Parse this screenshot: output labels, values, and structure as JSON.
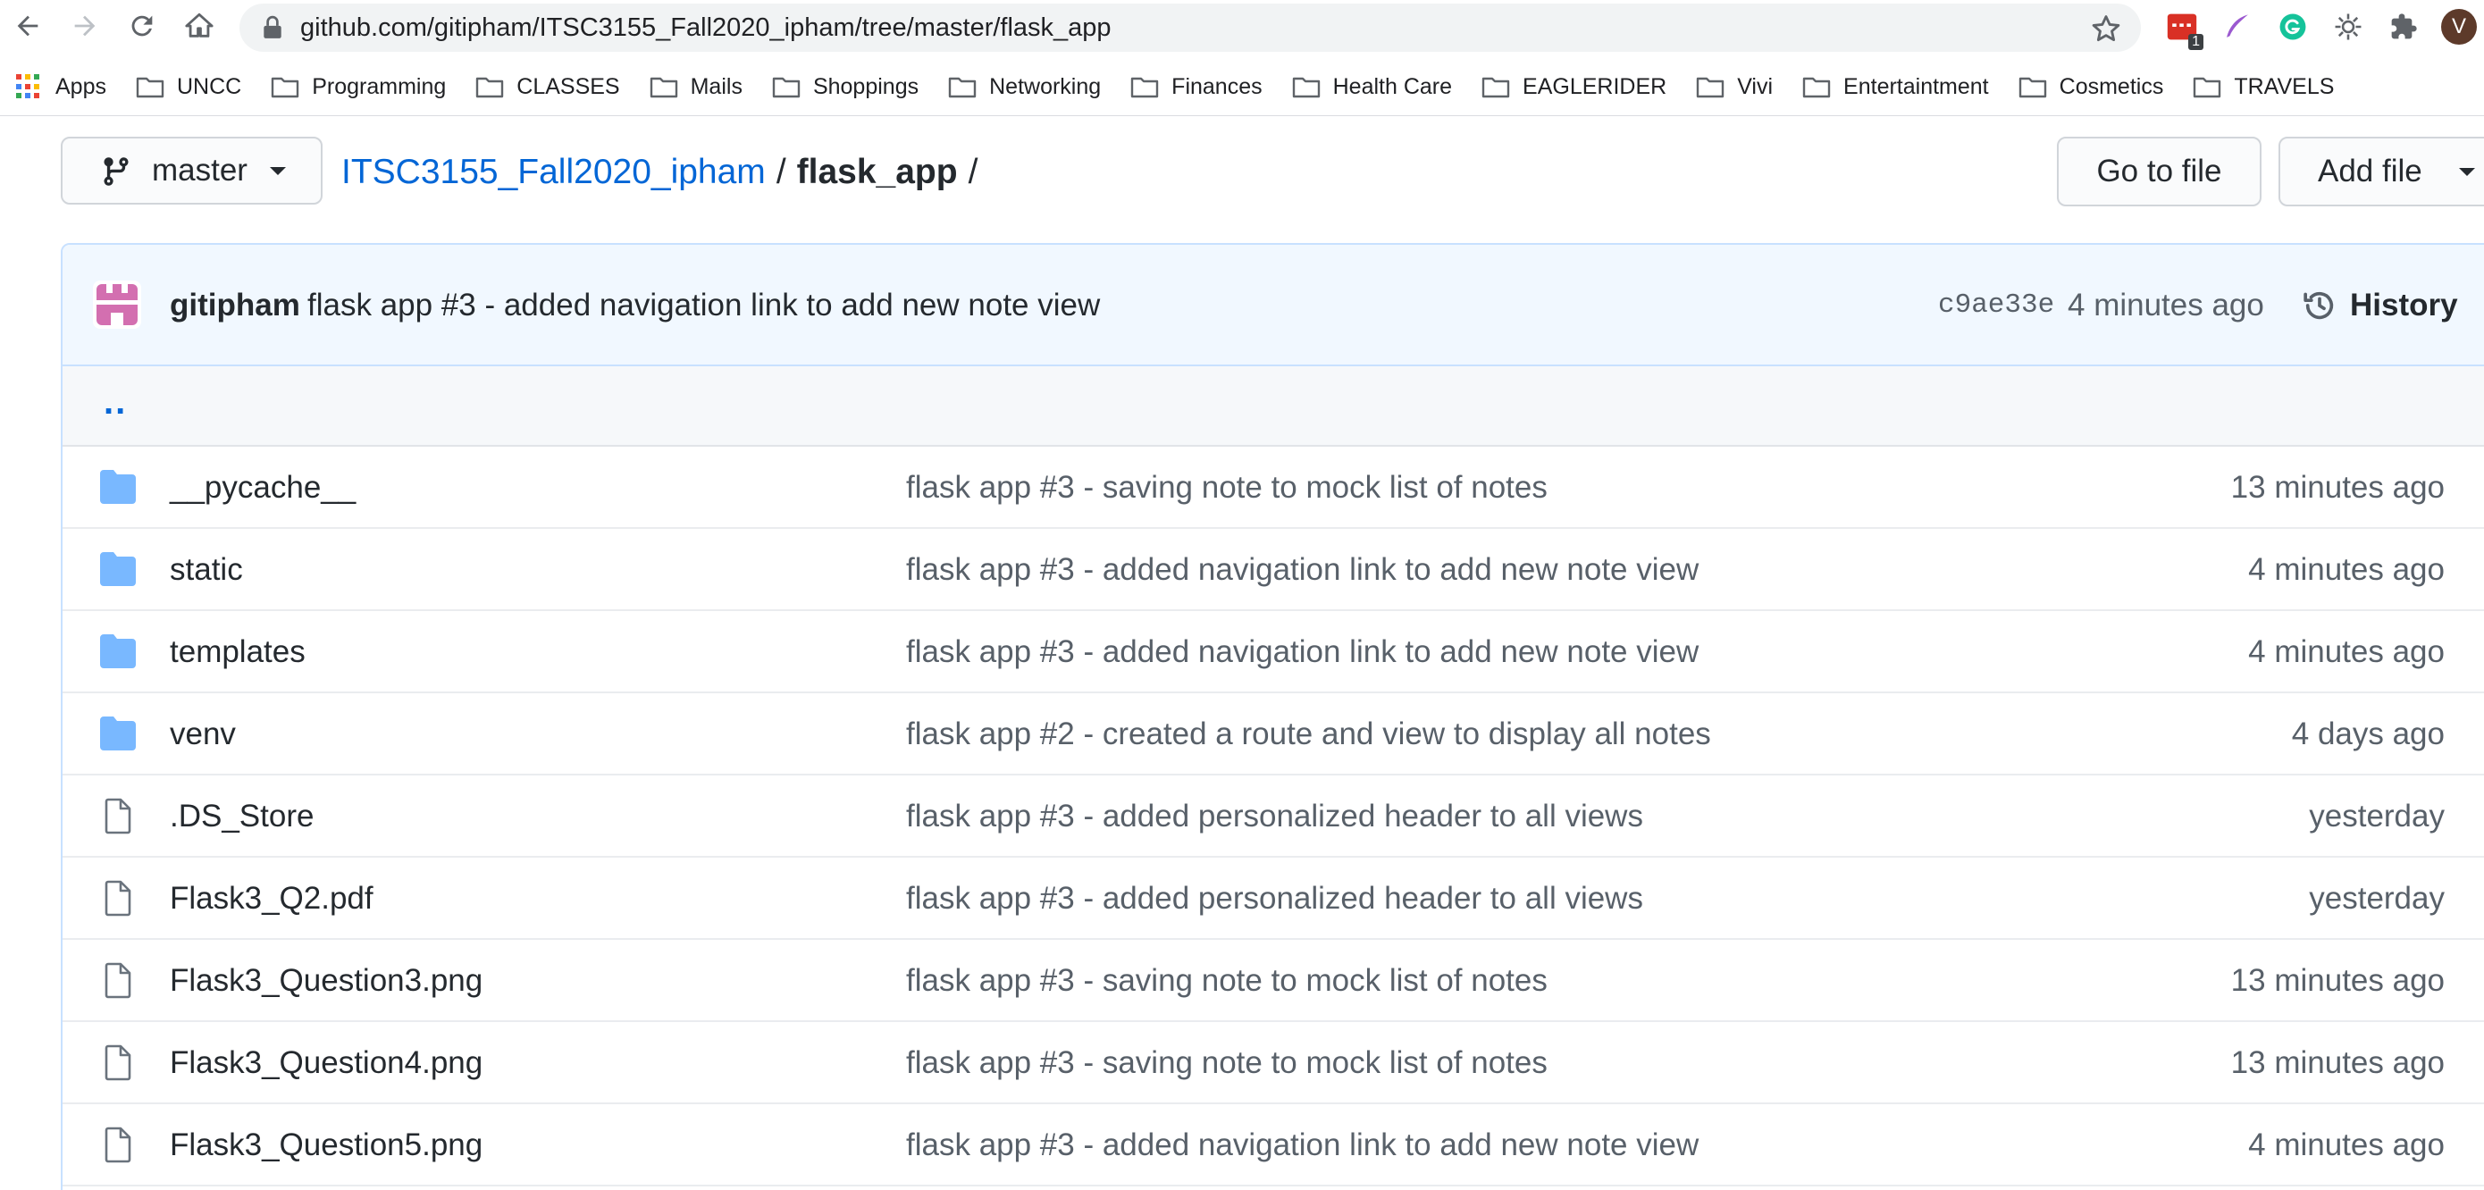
{
  "browser": {
    "url_host": "github.com",
    "url_path": "/gitipham/ITSC3155_Fall2020_ipham/tree/master/flask_app",
    "extension_badge": "1",
    "profile_initial": "V"
  },
  "bookmarks": [
    {
      "label": "Apps",
      "icon": "apps-grid-icon"
    },
    {
      "label": "UNCC",
      "icon": "folder-icon"
    },
    {
      "label": "Programming",
      "icon": "folder-icon"
    },
    {
      "label": "CLASSES",
      "icon": "folder-icon"
    },
    {
      "label": "Mails",
      "icon": "folder-icon"
    },
    {
      "label": "Shoppings",
      "icon": "folder-icon"
    },
    {
      "label": "Networking",
      "icon": "folder-icon"
    },
    {
      "label": "Finances",
      "icon": "folder-icon"
    },
    {
      "label": "Health Care",
      "icon": "folder-icon"
    },
    {
      "label": "EAGLERIDER",
      "icon": "folder-icon"
    },
    {
      "label": "Vivi",
      "icon": "folder-icon"
    },
    {
      "label": "Entertaintment",
      "icon": "folder-icon"
    },
    {
      "label": "Cosmetics",
      "icon": "folder-icon"
    },
    {
      "label": "TRAVELS",
      "icon": "folder-icon"
    }
  ],
  "repo": {
    "branch": "master",
    "repo_name": "ITSC3155_Fall2020_ipham",
    "separator": "/",
    "directory": "flask_app",
    "trailing_separator": "/",
    "goto_file_label": "Go to file",
    "add_file_label": "Add file"
  },
  "latest_commit": {
    "author": "gitipham",
    "message": "flask app #3 - added navigation link to add new note view",
    "sha": "c9ae33e",
    "time": "4 minutes ago",
    "history_label": "History"
  },
  "parent_dir_label": "..",
  "files": [
    {
      "type": "folder",
      "name": "__pycache__",
      "commit": "flask app #3 - saving note to mock list of notes",
      "age": "13 minutes ago"
    },
    {
      "type": "folder",
      "name": "static",
      "commit": "flask app #3 - added navigation link to add new note view",
      "age": "4 minutes ago"
    },
    {
      "type": "folder",
      "name": "templates",
      "commit": "flask app #3 - added navigation link to add new note view",
      "age": "4 minutes ago"
    },
    {
      "type": "folder",
      "name": "venv",
      "commit": "flask app #2 - created a route and view to display all notes",
      "age": "4 days ago"
    },
    {
      "type": "file",
      "name": ".DS_Store",
      "commit": "flask app #3 - added personalized header to all views",
      "age": "yesterday"
    },
    {
      "type": "file",
      "name": "Flask3_Q2.pdf",
      "commit": "flask app #3 - added personalized header to all views",
      "age": "yesterday"
    },
    {
      "type": "file",
      "name": "Flask3_Question3.png",
      "commit": "flask app #3 - saving note to mock list of notes",
      "age": "13 minutes ago"
    },
    {
      "type": "file",
      "name": "Flask3_Question4.png",
      "commit": "flask app #3 - saving note to mock list of notes",
      "age": "13 minutes ago"
    },
    {
      "type": "file",
      "name": "Flask3_Question5.png",
      "commit": "flask app #3 - added navigation link to add new note view",
      "age": "4 minutes ago"
    }
  ],
  "colors": {
    "link_blue": "#0366d6",
    "folder_blue": "#79b8ff",
    "commit_bar_bg": "#f1f8ff",
    "muted_text": "#586069"
  }
}
